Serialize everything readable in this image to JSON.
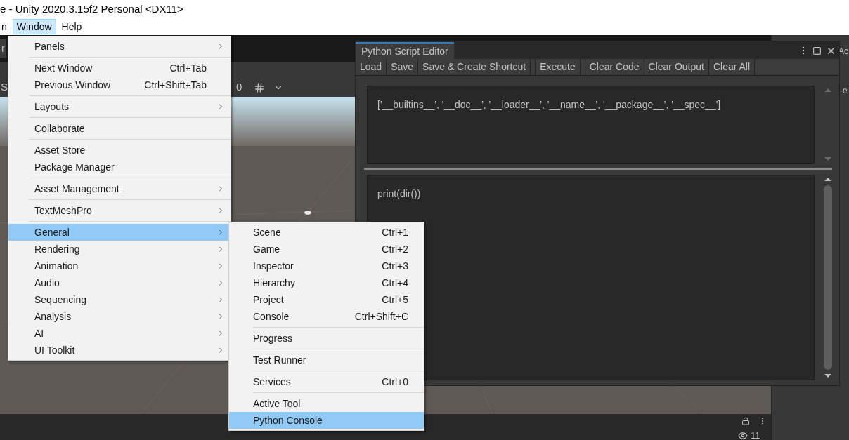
{
  "title_bar": {
    "title": "e - Unity 2020.3.15f2 Personal <DX11>"
  },
  "menu_bar": [
    {
      "label": "n",
      "selected": false
    },
    {
      "label": "Window",
      "selected": true
    },
    {
      "label": "Help",
      "selected": false
    }
  ],
  "scene_view": {
    "tab_fragment": "r",
    "toolbar_fragments": [
      "S",
      "0"
    ]
  },
  "right_panel": {
    "fragments": [
      "Ac",
      "-e"
    ]
  },
  "bottom_bar": {
    "count": "11"
  },
  "window_menu": [
    [
      {
        "label": "Panels",
        "submenu": true,
        "selected": false
      }
    ],
    [
      {
        "label": "Next Window",
        "shortcut": "Ctrl+Tab",
        "submenu": false,
        "selected": false
      },
      {
        "label": "Previous Window",
        "shortcut": "Ctrl+Shift+Tab",
        "submenu": false,
        "selected": false
      }
    ],
    [
      {
        "label": "Layouts",
        "submenu": true,
        "selected": false
      }
    ],
    [
      {
        "label": "Collaborate",
        "submenu": false,
        "selected": false
      }
    ],
    [
      {
        "label": "Asset Store",
        "submenu": false,
        "selected": false
      },
      {
        "label": "Package Manager",
        "submenu": false,
        "selected": false
      }
    ],
    [
      {
        "label": "Asset Management",
        "submenu": true,
        "selected": false
      }
    ],
    [
      {
        "label": "TextMeshPro",
        "submenu": true,
        "selected": false
      }
    ],
    [
      {
        "label": "General",
        "submenu": true,
        "selected": true
      },
      {
        "label": "Rendering",
        "submenu": true,
        "selected": false
      },
      {
        "label": "Animation",
        "submenu": true,
        "selected": false
      },
      {
        "label": "Audio",
        "submenu": true,
        "selected": false
      },
      {
        "label": "Sequencing",
        "submenu": true,
        "selected": false
      },
      {
        "label": "Analysis",
        "submenu": true,
        "selected": false
      },
      {
        "label": "AI",
        "submenu": true,
        "selected": false
      },
      {
        "label": "UI Toolkit",
        "submenu": true,
        "selected": false
      }
    ]
  ],
  "general_submenu": [
    [
      {
        "label": "Scene",
        "shortcut": "Ctrl+1",
        "selected": false
      },
      {
        "label": "Game",
        "shortcut": "Ctrl+2",
        "selected": false
      },
      {
        "label": "Inspector",
        "shortcut": "Ctrl+3",
        "selected": false
      },
      {
        "label": "Hierarchy",
        "shortcut": "Ctrl+4",
        "selected": false
      },
      {
        "label": "Project",
        "shortcut": "Ctrl+5",
        "selected": false
      },
      {
        "label": "Console",
        "shortcut": "Ctrl+Shift+C",
        "selected": false
      }
    ],
    [
      {
        "label": "Progress",
        "selected": false
      }
    ],
    [
      {
        "label": "Test Runner",
        "selected": false
      }
    ],
    [
      {
        "label": "Services",
        "shortcut": "Ctrl+0",
        "selected": false
      }
    ],
    [
      {
        "label": "Active Tool",
        "selected": false
      },
      {
        "label": "Python Console",
        "selected": true
      }
    ]
  ],
  "python_editor": {
    "tab": "Python Script Editor",
    "toolbar": [
      "Load",
      "Save",
      "Save & Create Shortcut",
      "Execute",
      "Clear Code",
      "Clear Output",
      "Clear All"
    ],
    "output": "['__builtins__', '__doc__', '__loader__', '__name__', '__package__', '__spec__']",
    "code": "print(dir())"
  }
}
